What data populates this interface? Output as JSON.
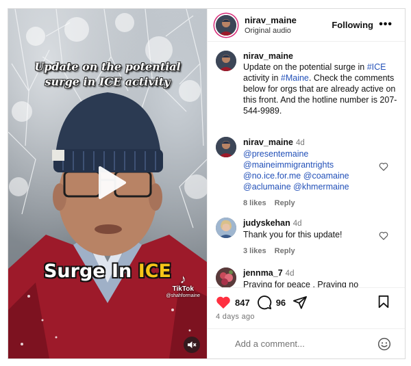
{
  "video": {
    "caption_top": "Update on the potential surge in ICE activity",
    "caption_main_prefix": "Surge In ",
    "caption_main_highlight": "ICE",
    "watermark_brand": "TikTok",
    "watermark_user": "@shahformaine",
    "icons": {
      "play": "play-icon",
      "mute": "speaker-muted-icon",
      "tiktok": "tiktok-logo-icon"
    }
  },
  "header": {
    "username": "nirav_maine",
    "audio": "Original audio",
    "follow_label": "Following",
    "more_label": "•••"
  },
  "caption_comment": {
    "username": "nirav_maine",
    "text_1": "Update on the potential surge in ",
    "tag_1": "#ICE",
    "text_2": " activity in ",
    "tag_2": "#Maine",
    "text_3": ". Check the comments below for orgs that are already active on this front. And the hotline number is 207-544-9989."
  },
  "comments": [
    {
      "username": "nirav_maine",
      "time": "4d",
      "mentions": [
        "@presentemaine",
        "@maineimmigrantrights",
        "@no.ice.for.me",
        "@coamaine",
        "@aclumaine",
        "@khmermaine"
      ],
      "likes": "8 likes",
      "reply": "Reply"
    },
    {
      "username": "judyskehan",
      "time": "4d",
      "text": "Thank you for this update!",
      "likes": "3 likes",
      "reply": "Reply"
    },
    {
      "username": "jennma_7",
      "time": "4d",
      "text": "Praying for peace . Praying no"
    }
  ],
  "actions": {
    "likes_count": "847",
    "comments_count": "96",
    "date": "4 days ago",
    "icons": [
      "heart-filled-icon",
      "comment-icon",
      "share-icon",
      "bookmark-icon"
    ]
  },
  "add_comment": {
    "placeholder": "Add a comment..."
  },
  "colors": {
    "like_red": "#ff3040",
    "link_blue": "#2250b8",
    "caption_yellow": "#f6c518",
    "muted_gray": "#737373"
  }
}
